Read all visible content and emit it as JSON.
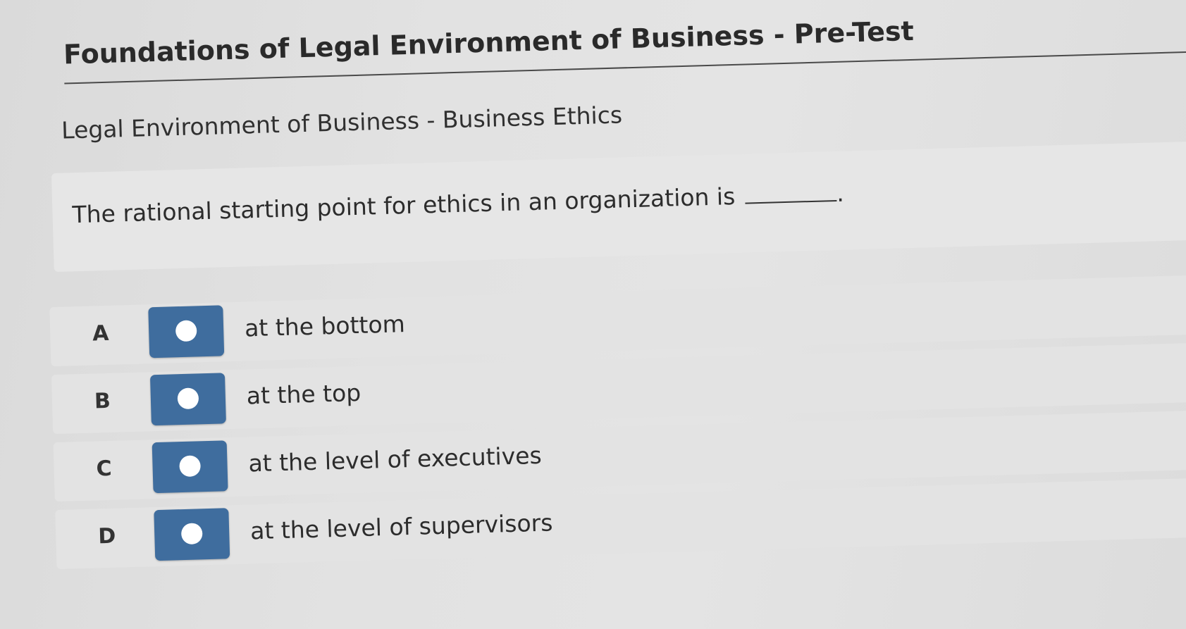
{
  "page": {
    "title": "Foundations of Legal Environment of Business - Pre-Test",
    "subtitle": "Legal Environment of Business - Business Ethics"
  },
  "question": {
    "text": "The rational starting point for ethics in an organization is",
    "end_punct": "."
  },
  "options": [
    {
      "letter": "A",
      "text": "at the bottom"
    },
    {
      "letter": "B",
      "text": "at the top"
    },
    {
      "letter": "C",
      "text": "at the level of executives"
    },
    {
      "letter": "D",
      "text": "at the level of supervisors"
    }
  ],
  "colors": {
    "radio_button": "#3f6d9e",
    "background": "#e2e2e2"
  }
}
